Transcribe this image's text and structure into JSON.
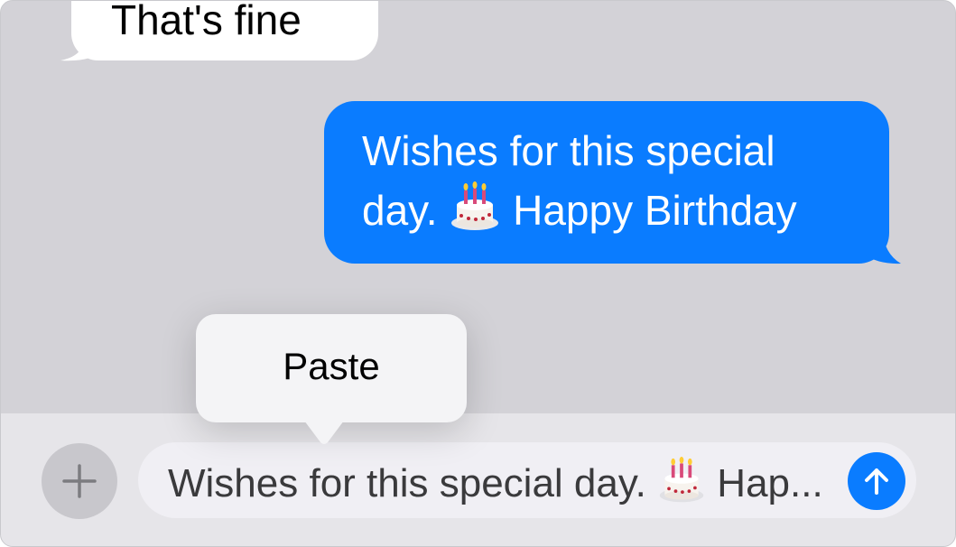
{
  "conversation": {
    "incoming_message": "That's fine",
    "outgoing_message_line1": "Wishes for this special",
    "outgoing_message_line2_pre": "day.",
    "outgoing_message_line2_post": "Happy Birthday",
    "emoji": "birthday-cake-emoji"
  },
  "context_menu": {
    "paste_label": "Paste"
  },
  "composer": {
    "input_value_pre": "Wishes for this special day.",
    "input_value_post": "Hap...",
    "plus_icon": "plus-icon",
    "send_icon": "arrow-up-icon"
  },
  "colors": {
    "background": "#d3d2d7",
    "outgoing_bubble": "#0a7cff",
    "incoming_bubble": "#ffffff",
    "send_button": "#0a7cff"
  }
}
